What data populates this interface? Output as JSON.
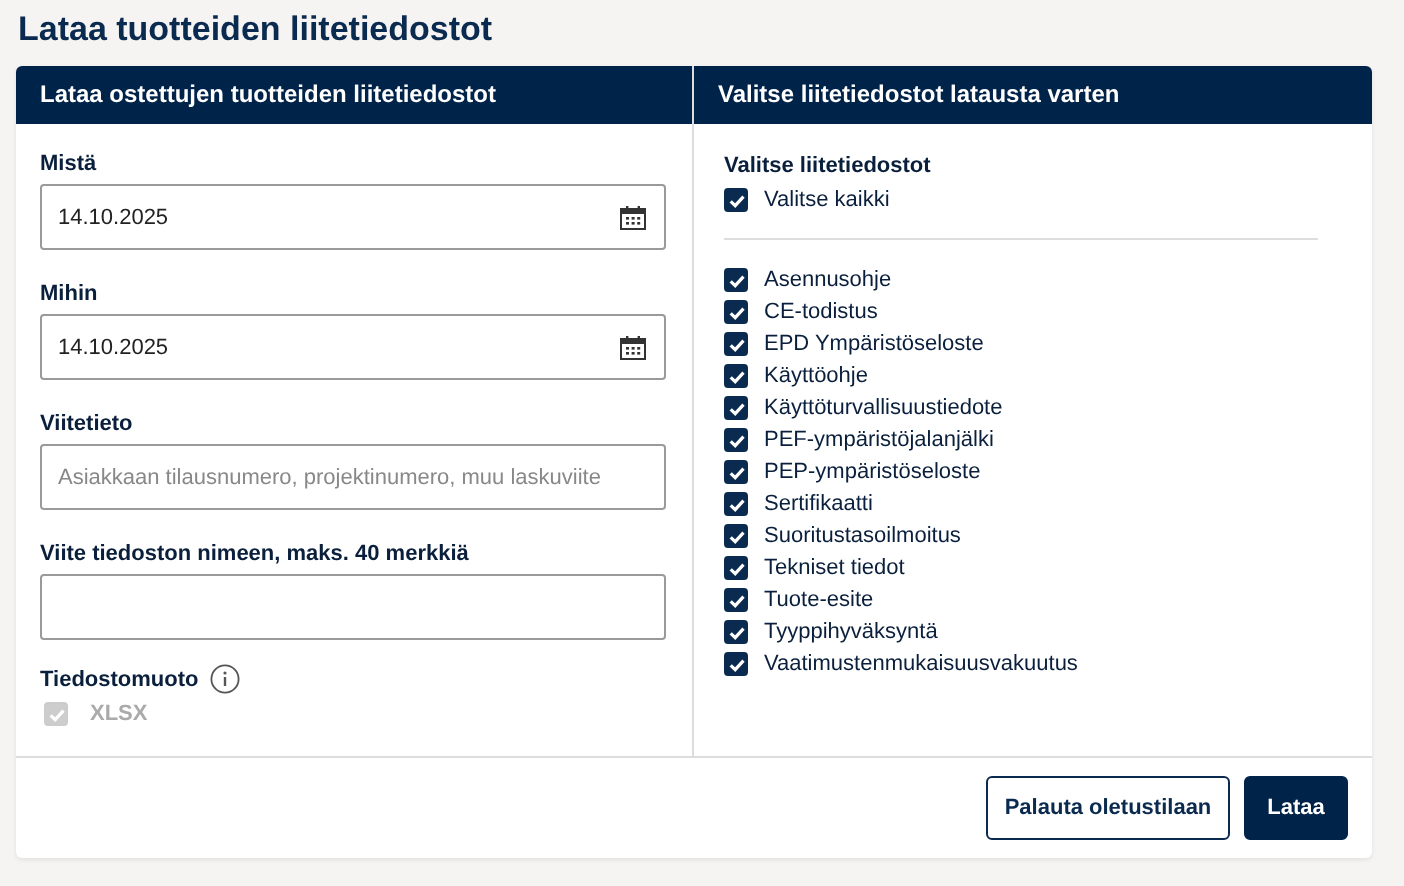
{
  "title": "Lataa tuotteiden liitetiedostot",
  "left_panel": {
    "heading": "Lataa ostettujen tuotteiden liitetiedostot",
    "fields": [
      {
        "label": "Mistä",
        "value": "14.10.2025",
        "kind": "date"
      },
      {
        "label": "Mihin",
        "value": "14.10.2025",
        "kind": "date"
      },
      {
        "label": "Viitetieto",
        "placeholder": "Asiakkaan tilausnumero, projektinumero, muu laskuviite",
        "kind": "text"
      },
      {
        "label": "Viite tiedoston nimeen, maks. 40 merkkiä",
        "kind": "text"
      }
    ],
    "format": {
      "label": "Tiedostomuoto",
      "options": [
        {
          "label": "XLSX",
          "checked": true,
          "disabled": true
        }
      ]
    }
  },
  "right_panel": {
    "heading": "Valitse liitetiedostot latausta varten",
    "group_label": "Valitse liitetiedostot",
    "select_all": {
      "label": "Valitse kaikki",
      "checked": true
    },
    "items": [
      {
        "label": "Asennusohje",
        "checked": true
      },
      {
        "label": "CE-todistus",
        "checked": true
      },
      {
        "label": "EPD Ympäristöseloste",
        "checked": true
      },
      {
        "label": "Käyttöohje",
        "checked": true
      },
      {
        "label": "Käyttöturvallisuustiedote",
        "checked": true
      },
      {
        "label": "PEF-ympäristöjalanjälki",
        "checked": true
      },
      {
        "label": "PEP-ympäristöseloste",
        "checked": true
      },
      {
        "label": "Sertifikaatti",
        "checked": true
      },
      {
        "label": "Suoritustasoilmoitus",
        "checked": true
      },
      {
        "label": "Tekniset tiedot",
        "checked": true
      },
      {
        "label": "Tuote-esite",
        "checked": true
      },
      {
        "label": "Tyyppihyväksyntä",
        "checked": true
      },
      {
        "label": "Vaatimustenmukaisuusvakuutus",
        "checked": true
      }
    ]
  },
  "buttons": [
    {
      "label": "Palauta oletustilaan",
      "kind": "secondary"
    },
    {
      "label": "Lataa",
      "kind": "primary"
    }
  ]
}
